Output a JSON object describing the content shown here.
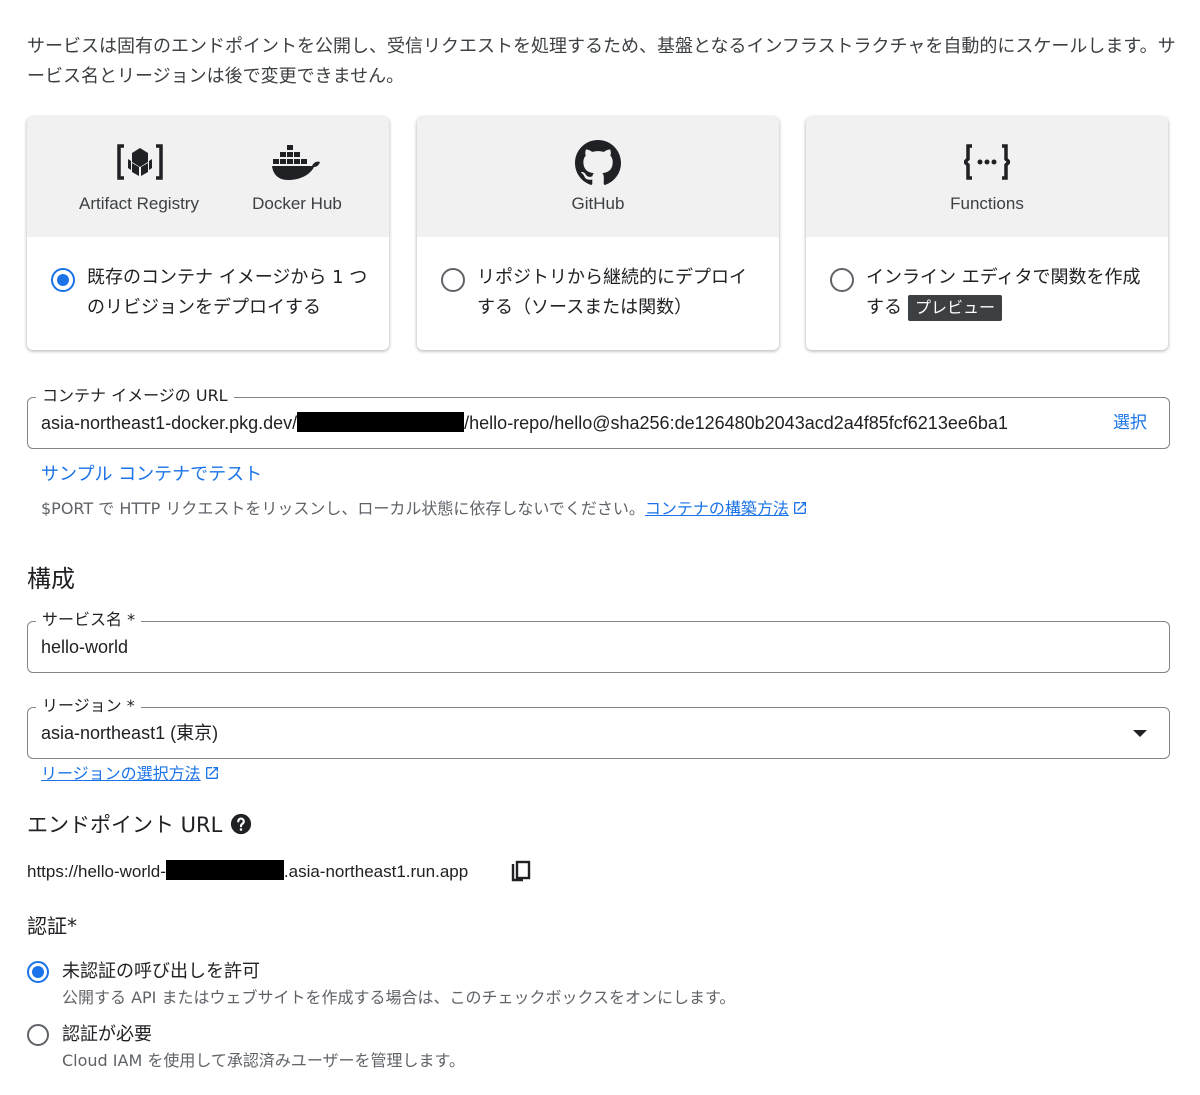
{
  "intro": "サービスは固有のエンドポイントを公開し、受信リクエストを処理するため、基盤となるインフラストラクチャを自動的にスケールします。サービス名とリージョンは後で変更できません。",
  "cards": [
    {
      "labels": [
        "Artifact Registry",
        "Docker Hub"
      ],
      "text": "既存のコンテナ イメージから 1 つのリビジョンをデプロイする",
      "selected": true
    },
    {
      "labels": [
        "GitHub"
      ],
      "text": "リポジトリから継続的にデプロイする（ソースまたは関数）",
      "selected": false
    },
    {
      "labels": [
        "Functions"
      ],
      "text": "インライン エディタで関数を作成する",
      "badge": "プレビュー",
      "selected": false
    }
  ],
  "icons": {
    "card1": [
      "artifact-registry-icon",
      "docker-hub-icon"
    ],
    "card2": "github-icon",
    "card3": "functions-icon",
    "external": "external-link-icon",
    "help": "help-icon",
    "copy": "copy-icon"
  },
  "container": {
    "label": "コンテナ イメージの URL",
    "value_prefix": "asia-northeast1-docker.pkg.dev/",
    "value_suffix": "/hello-repo/hello@sha256:de126480b2043acd2a4f85fcf6213ee6ba1",
    "select_label": "選択"
  },
  "sample_link": "サンプル コンテナでテスト",
  "hint": {
    "text": "$PORT で HTTP リクエストをリッスンし、ローカル状態に依存しないでください。",
    "link": "コンテナの構築方法"
  },
  "config": {
    "title": "構成",
    "service_name_label": "サービス名 *",
    "service_name_value": "hello-world",
    "region_label": "リージョン *",
    "region_value": "asia-northeast1 (東京)",
    "region_link": "リージョンの選択方法"
  },
  "endpoint": {
    "title": "エンドポイント URL",
    "url_prefix": "https://hello-world-",
    "url_suffix": ".asia-northeast1.run.app"
  },
  "auth": {
    "title": "認証*",
    "options": [
      {
        "title": "未認証の呼び出しを許可",
        "desc": "公開する API またはウェブサイトを作成する場合は、このチェックボックスをオンにします。",
        "selected": true
      },
      {
        "title": "認証が必要",
        "desc": "Cloud IAM を使用して承認済みユーザーを管理します。",
        "selected": false
      }
    ]
  },
  "colors": {
    "accent": "#1a73e8",
    "card_header_bg": "#f1f1f1",
    "badge_bg": "#3c4043"
  }
}
